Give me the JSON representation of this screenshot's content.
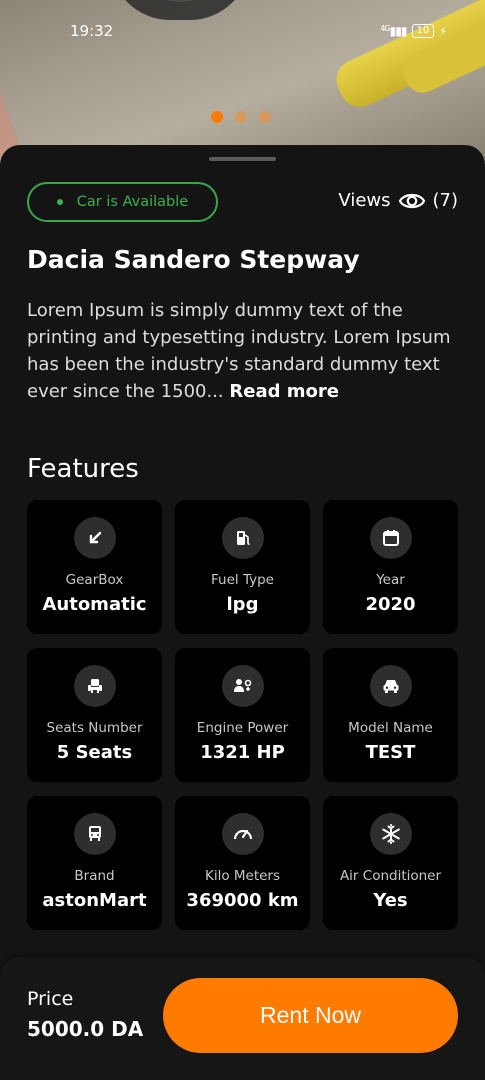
{
  "status_bar": {
    "time": "19:32",
    "network": "4G",
    "battery": "10"
  },
  "gallery": {
    "pages": 3,
    "active_index": 0
  },
  "availability": {
    "label": "Car is Available",
    "color": "#3fb04e"
  },
  "views": {
    "label": "Views",
    "count": "(7)"
  },
  "car": {
    "title": "Dacia Sandero Stepway",
    "description": "Lorem Ipsum is simply dummy text of the printing and typesetting industry. Lorem Ipsum has been the industry's standard dummy text ever since the 1500...",
    "read_more": "Read more"
  },
  "features": {
    "heading": "Features",
    "items": [
      {
        "label": "GearBox",
        "value": "Automatic",
        "icon": "gearbox-arrow-icon"
      },
      {
        "label": "Fuel Type",
        "value": "lpg",
        "icon": "fuel-pump-icon"
      },
      {
        "label": "Year",
        "value": "2020",
        "icon": "calendar-icon"
      },
      {
        "label": "Seats Number",
        "value": "5 Seats",
        "icon": "seat-icon"
      },
      {
        "label": "Engine Power",
        "value": "1321 HP",
        "icon": "engine-power-icon"
      },
      {
        "label": "Model Name",
        "value": "TEST",
        "icon": "car-front-icon"
      },
      {
        "label": "Brand",
        "value": "astonMart",
        "icon": "car-brand-icon"
      },
      {
        "label": "Kilo Meters",
        "value": "369000 km",
        "icon": "speedometer-icon"
      },
      {
        "label": "Air Conditioner",
        "value": "Yes",
        "icon": "snowflake-icon"
      }
    ]
  },
  "footer": {
    "price_label": "Price",
    "price_value": "5000.0 DA",
    "rent_button": "Rent Now"
  },
  "colors": {
    "accent": "#ff7b00",
    "available": "#3fb04e",
    "card_bg": "#000000",
    "sheet_bg": "#141414"
  }
}
